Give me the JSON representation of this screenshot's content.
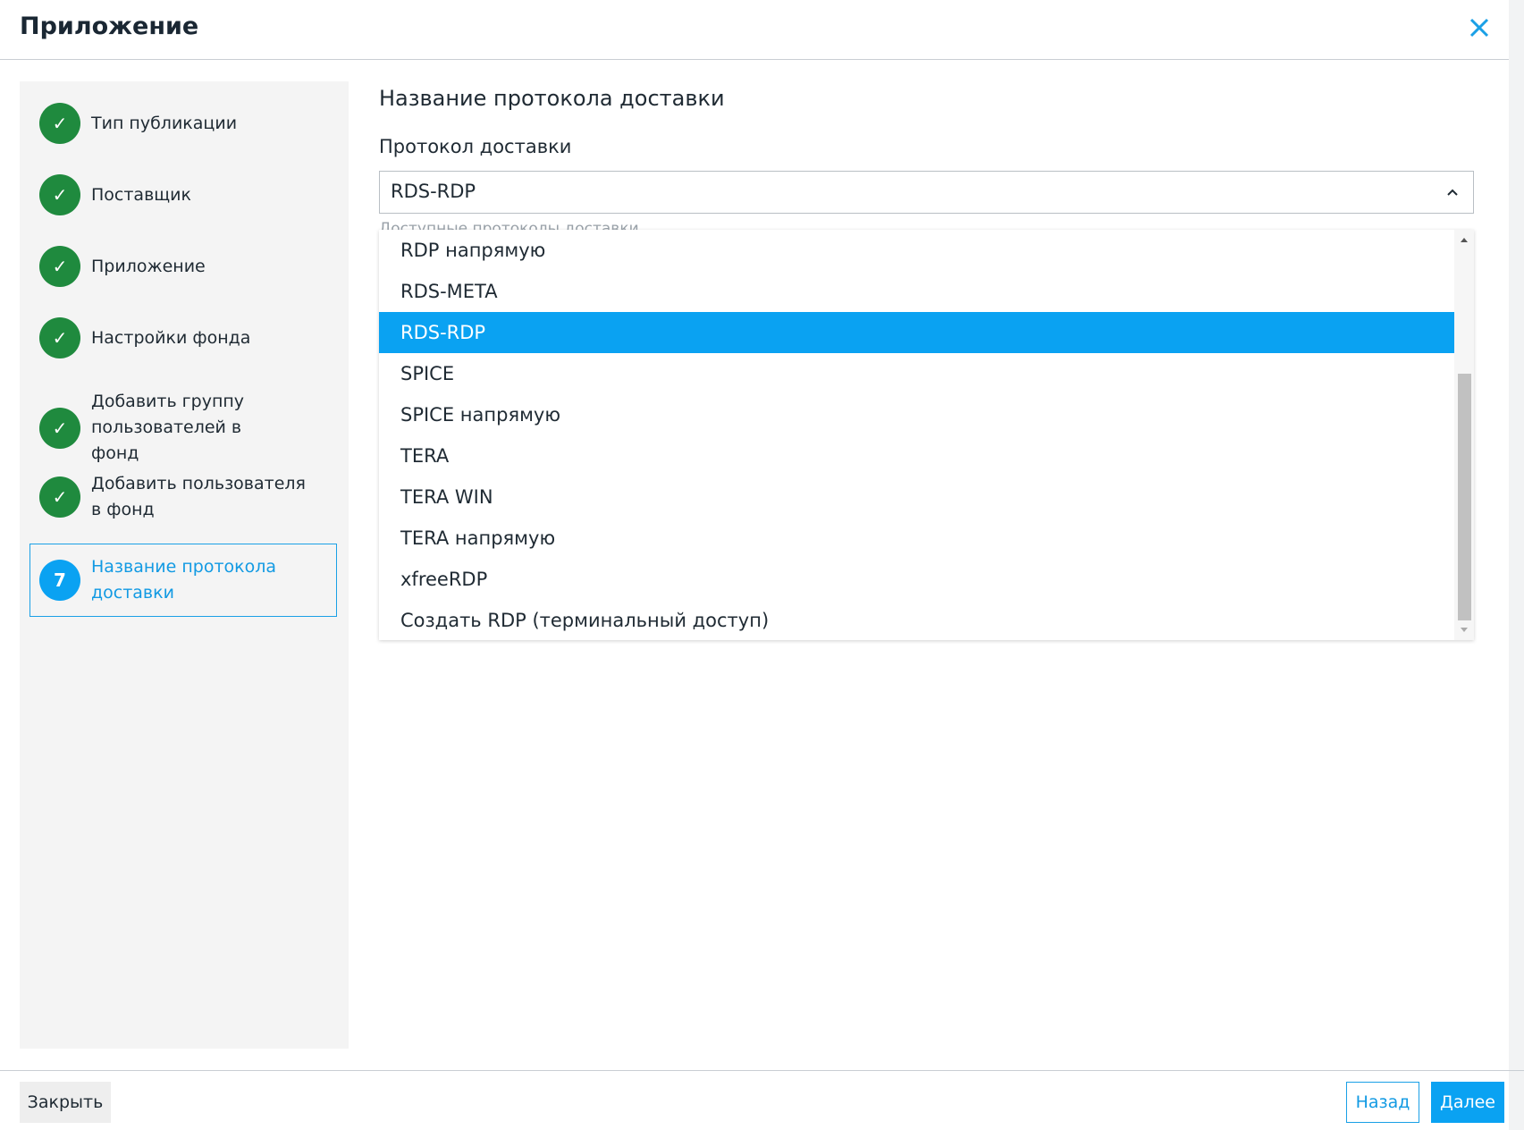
{
  "header": {
    "title": "Приложение"
  },
  "steps": [
    {
      "label": "Тип публикации",
      "status": "done",
      "mark": "✓"
    },
    {
      "label": "Поставщик",
      "status": "done",
      "mark": "✓"
    },
    {
      "label": "Приложение",
      "status": "done",
      "mark": "✓"
    },
    {
      "label": "Настройки фонда",
      "status": "done",
      "mark": "✓"
    },
    {
      "label": "Добавить группу пользователей в фонд",
      "status": "done",
      "mark": "✓"
    },
    {
      "label": "Добавить пользователя в фонд",
      "status": "done",
      "mark": "✓"
    },
    {
      "label": "Название протокола доставки",
      "status": "active",
      "mark": "7"
    }
  ],
  "main": {
    "title": "Название протокола доставки",
    "field_label": "Протокол доставки",
    "selected_value": "RDS-RDP",
    "hint": "Доступные протоколы доставки",
    "options": [
      "RDP напрямую",
      "RDS-META",
      "RDS-RDP",
      "SPICE",
      "SPICE напрямую",
      "TERA",
      "TERA WIN",
      "TERA напрямую",
      "xfreeRDP",
      "Создать RDP (терминальный доступ)"
    ]
  },
  "footer": {
    "close_label": "Закрыть",
    "back_label": "Назад",
    "next_label": "Далее"
  },
  "colors": {
    "accent": "#0aa2f2",
    "done": "#1f8a3e",
    "sidebar_bg": "#f4f4f4"
  },
  "icons": {
    "close": "close-icon",
    "chevron": "chevron-up-icon",
    "check": "check-icon"
  }
}
